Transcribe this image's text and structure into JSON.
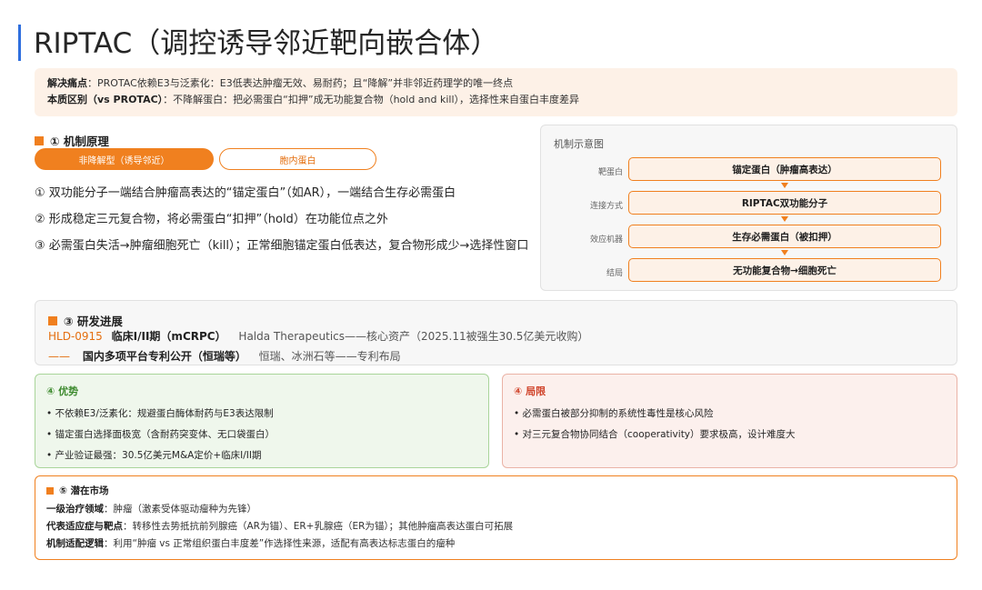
{
  "title": "RIPTAC（调控诱导邻近靶向嵌合体）",
  "pain": {
    "line1_label": "解决痛点",
    "line1_text": "：PROTAC依赖E3与泛素化：E3低表达肿瘤无效、易耐药；且“降解”并非邻近药理学的唯一终点",
    "line2_label": "本质区别（vs PROTAC）",
    "line2_text": "：不降解蛋白：把必需蛋白“扣押”成无功能复合物（hold and kill），选择性来自蛋白丰度差异"
  },
  "mechanism": {
    "heading": "① 机制原理",
    "pill_active": "非降解型（诱导邻近）",
    "pill_outline": "胞内蛋白",
    "points": [
      "① 双功能分子一端结合肿瘤高表达的“锚定蛋白”（如AR），一端结合生存必需蛋白",
      "② 形成稳定三元复合物，将必需蛋白“扣押”（hold）在功能位点之外",
      "③ 必需蛋白失活→肿瘤细胞死亡（kill）；正常细胞锚定蛋白低表达，复合物形成少→选择性窗口"
    ]
  },
  "diagram": {
    "title": "机制示意图",
    "rows": [
      {
        "label": "靶蛋白",
        "box": "锚定蛋白（肿瘤高表达）"
      },
      {
        "label": "连接方式",
        "box": "RIPTAC双功能分子"
      },
      {
        "label": "效应机器",
        "box": "生存必需蛋白（被扣押）"
      },
      {
        "label": "结局",
        "box": "无功能复合物→细胞死亡"
      }
    ]
  },
  "progress": {
    "heading": "③ 研发进展",
    "row1_code": "HLD-0915",
    "row1_phase": "临床I/II期（mCRPC）",
    "row1_rest": "Halda Therapeutics——核心资产（2025.11被强生30.5亿美元收购）",
    "row2_dash": "——",
    "row2_bold": "国内多项平台专利公开（恒瑞等）",
    "row2_rest": "恒瑞、冰洲石等——专利布局"
  },
  "advantages": {
    "title": "④ 优势",
    "items": [
      "• 不依赖E3/泛素化：规避蛋白酶体耐药与E3表达限制",
      "• 锚定蛋白选择面极宽（含耐药突变体、无口袋蛋白）",
      "• 产业验证最强：30.5亿美元M&A定价+临床I/II期"
    ]
  },
  "limitations": {
    "title": "④ 局限",
    "items": [
      "• 必需蛋白被部分抑制的系统性毒性是核心风险",
      "• 对三元复合物协同结合（cooperativity）要求极高，设计难度大"
    ]
  },
  "market": {
    "heading": "⑤ 潜在市场",
    "lines": [
      {
        "label": "一级治疗领域",
        "text": "：肿瘤（激素受体驱动瘤种为先锋）"
      },
      {
        "label": "代表适应症与靶点",
        "text": "：转移性去势抵抗前列腺癌（AR为锚）、ER+乳腺癌（ER为锚）；其他肿瘤高表达蛋白可拓展"
      },
      {
        "label": "机制适配逻辑",
        "text": "：利用“肿瘤 vs 正常组织蛋白丰度差”作选择性来源，适配有高表达标志蛋白的瘤种"
      }
    ]
  },
  "colors": {
    "accent": "#f0801f",
    "title_bar": "#2f6fde",
    "advantage_green": "#3d8a2e",
    "limitation_red": "#d0442b"
  }
}
